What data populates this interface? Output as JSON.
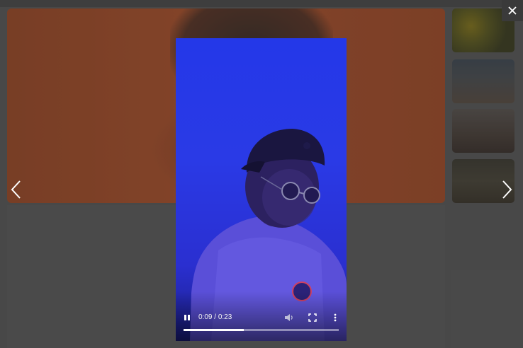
{
  "lightbox": {
    "close_icon": "close-icon",
    "prev_icon": "chevron-left-icon",
    "next_icon": "chevron-right-icon"
  },
  "video": {
    "current_time": "0:09",
    "separator": " / ",
    "duration": "0:23",
    "progress_fraction": 0.39,
    "state": "playing",
    "icons": [
      "pause-icon",
      "volume-icon",
      "fullscreen-icon",
      "more-vert-icon"
    ],
    "background_color": "#2438e8"
  },
  "gallery": {
    "thumbnails": [
      "yellow-flowers",
      "city-landscape",
      "person-silhouette",
      "dark-forest"
    ]
  }
}
